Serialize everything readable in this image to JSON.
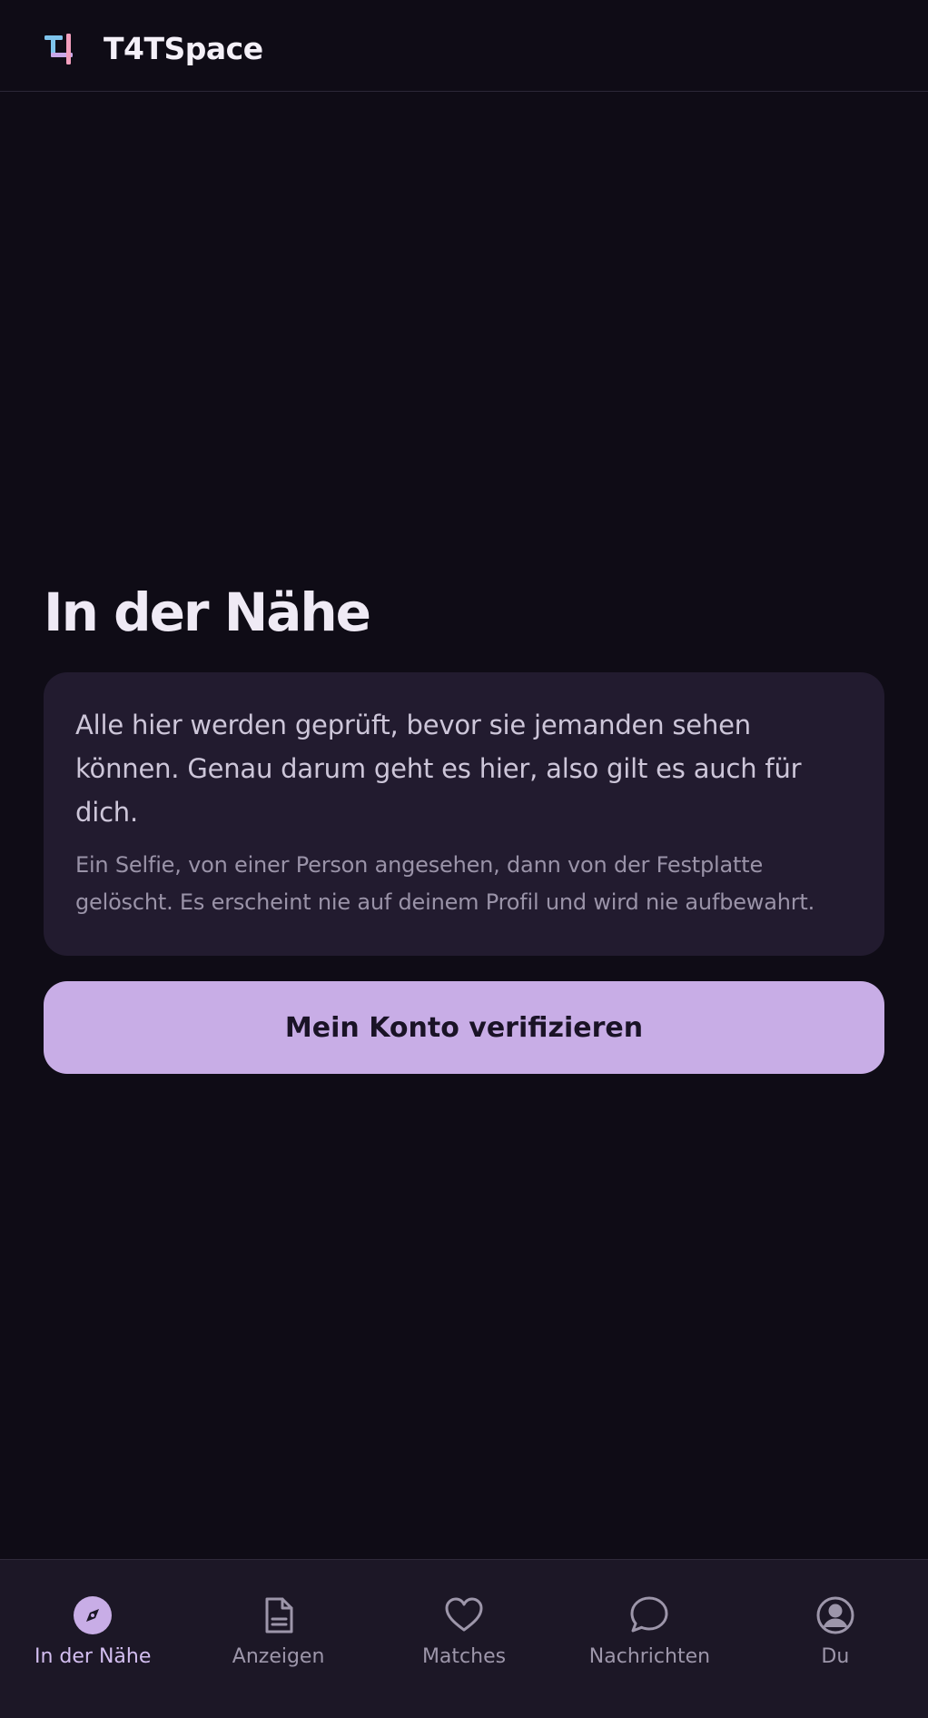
{
  "header": {
    "app_title": "T4TSpace",
    "logo_icon": "t4-logo-icon"
  },
  "main": {
    "page_title": "In der Nähe",
    "verification_card": {
      "lead": "Alle hier werden geprüft, bevor sie jemanden sehen können. Genau darum geht es hier, also gilt es auch für dich.",
      "note": "Ein Selfie, von einer Person angesehen, dann von der Festplatte gelöscht. Es erscheint nie auf deinem Profil und wird nie aufbewahrt."
    },
    "verify_button_label": "Mein Konto verifizieren"
  },
  "bottom_nav": {
    "items": [
      {
        "label": "In der Nähe",
        "icon": "compass-icon",
        "active": true
      },
      {
        "label": "Anzeigen",
        "icon": "document-icon",
        "active": false
      },
      {
        "label": "Matches",
        "icon": "heart-icon",
        "active": false
      },
      {
        "label": "Nachrichten",
        "icon": "chat-bubble-icon",
        "active": false
      },
      {
        "label": "Du",
        "icon": "user-circle-icon",
        "active": false
      }
    ]
  },
  "colors": {
    "background": "#0f0c16",
    "card": "#221b2f",
    "accent": "#c8ade6",
    "nav_background": "#1c1726",
    "active_label": "#d3bef0",
    "inactive_label": "#9d96aa",
    "logo_blue": "#7fc4ec",
    "logo_pink": "#f29fbd"
  }
}
